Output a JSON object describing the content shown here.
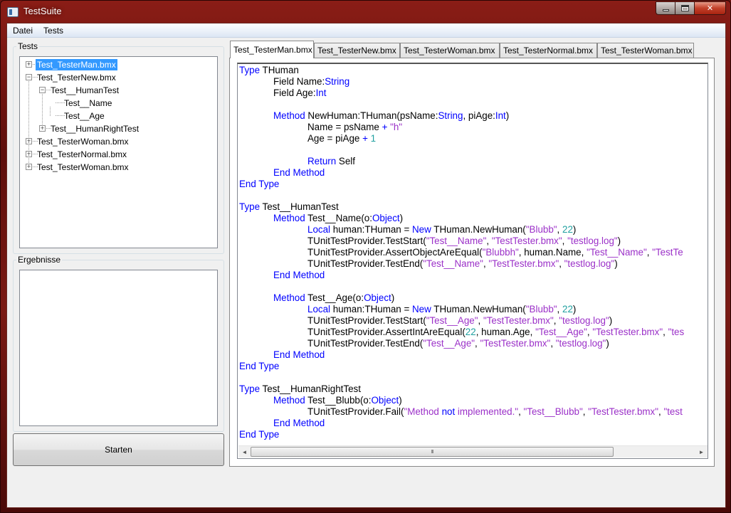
{
  "window": {
    "title": "TestSuite"
  },
  "menu": [
    "Datei",
    "Tests"
  ],
  "groups": {
    "tests": "Tests",
    "results": "Ergebnisse"
  },
  "tree": [
    {
      "label": "Test_TesterMan.bmx",
      "level": 0,
      "expander": "+",
      "selected": true
    },
    {
      "label": "Test_TesterNew.bmx",
      "level": 0,
      "expander": "-"
    },
    {
      "label": "Test__HumanTest",
      "level": 1,
      "expander": "-"
    },
    {
      "label": "Test__Name",
      "level": 2,
      "expander": ""
    },
    {
      "label": "Test__Age",
      "level": 2,
      "expander": ""
    },
    {
      "label": "Test__HumanRightTest",
      "level": 1,
      "expander": "+"
    },
    {
      "label": "Test_TesterWoman.bmx",
      "level": 0,
      "expander": "+"
    },
    {
      "label": "Test_TesterNormal.bmx",
      "level": 0,
      "expander": "+"
    },
    {
      "label": "Test_TesterWoman.bmx",
      "level": 0,
      "expander": "+"
    }
  ],
  "start_button": "Starten",
  "tabs": [
    "Test_TesterMan.bmx",
    "Test_TesterNew.bmx",
    "Test_TesterWoman.bmx",
    "Test_TesterNormal.bmx",
    "Test_TesterWoman.bmx"
  ],
  "active_tab": 0,
  "scrollbar": {
    "left_arrow": "◄",
    "right_arrow": "►",
    "grip": "III"
  },
  "code": [
    {
      "indent": 0,
      "tokens": [
        [
          "kw",
          "Type"
        ],
        [
          "t",
          " THuman"
        ]
      ]
    },
    {
      "indent": 1,
      "tokens": [
        [
          "t",
          "Field Name:"
        ],
        [
          "kw",
          "String"
        ]
      ]
    },
    {
      "indent": 1,
      "tokens": [
        [
          "t",
          "Field Age:"
        ],
        [
          "kw",
          "Int"
        ]
      ]
    },
    {
      "indent": 0,
      "tokens": []
    },
    {
      "indent": 1,
      "tokens": [
        [
          "kw",
          "Method"
        ],
        [
          "t",
          " NewHuman:THuman(psName:"
        ],
        [
          "kw",
          "String"
        ],
        [
          "t",
          ", piAge:"
        ],
        [
          "kw",
          "Int"
        ],
        [
          "t",
          ")"
        ]
      ]
    },
    {
      "indent": 2,
      "tokens": [
        [
          "t",
          "Name = psName "
        ],
        [
          "kw",
          "+"
        ],
        [
          "t",
          " "
        ],
        [
          "str",
          "\"h\""
        ]
      ]
    },
    {
      "indent": 2,
      "tokens": [
        [
          "t",
          "Age = piAge "
        ],
        [
          "kw",
          "+"
        ],
        [
          "t",
          " "
        ],
        [
          "num",
          "1"
        ]
      ]
    },
    {
      "indent": 0,
      "tokens": []
    },
    {
      "indent": 2,
      "tokens": [
        [
          "kw",
          "Return"
        ],
        [
          "t",
          " Self"
        ]
      ]
    },
    {
      "indent": 1,
      "tokens": [
        [
          "kw",
          "End Method"
        ]
      ]
    },
    {
      "indent": 0,
      "tokens": [
        [
          "kw",
          "End Type"
        ]
      ]
    },
    {
      "indent": 0,
      "tokens": []
    },
    {
      "indent": 0,
      "tokens": [
        [
          "kw",
          "Type"
        ],
        [
          "t",
          " Test__HumanTest"
        ]
      ]
    },
    {
      "indent": 1,
      "tokens": [
        [
          "kw",
          "Method"
        ],
        [
          "t",
          " Test__Name(o:"
        ],
        [
          "kw",
          "Object"
        ],
        [
          "t",
          ")"
        ]
      ]
    },
    {
      "indent": 2,
      "tokens": [
        [
          "kw",
          "Local"
        ],
        [
          "t",
          " human:THuman = "
        ],
        [
          "kw",
          "New"
        ],
        [
          "t",
          " THuman.NewHuman("
        ],
        [
          "str",
          "\"Blubb\""
        ],
        [
          "t",
          ", "
        ],
        [
          "num",
          "22"
        ],
        [
          "t",
          ")"
        ]
      ]
    },
    {
      "indent": 2,
      "tokens": [
        [
          "t",
          "TUnitTestProvider.TestStart("
        ],
        [
          "str",
          "\"Test__Name\""
        ],
        [
          "t",
          ", "
        ],
        [
          "str",
          "\"TestTester.bmx\""
        ],
        [
          "t",
          ", "
        ],
        [
          "str",
          "\"testlog.log\""
        ],
        [
          "t",
          ")"
        ]
      ]
    },
    {
      "indent": 2,
      "tokens": [
        [
          "t",
          "TUnitTestProvider.AssertObjectAreEqual("
        ],
        [
          "str",
          "\"Blubbh\""
        ],
        [
          "t",
          ", human.Name, "
        ],
        [
          "str",
          "\"Test__Name\""
        ],
        [
          "t",
          ", "
        ],
        [
          "str",
          "\"TestTe"
        ]
      ]
    },
    {
      "indent": 2,
      "tokens": [
        [
          "t",
          "TUnitTestProvider.TestEnd("
        ],
        [
          "str",
          "\"Test__Name\""
        ],
        [
          "t",
          ", "
        ],
        [
          "str",
          "\"TestTester.bmx\""
        ],
        [
          "t",
          ", "
        ],
        [
          "str",
          "\"testlog.log\""
        ],
        [
          "t",
          ")"
        ]
      ]
    },
    {
      "indent": 1,
      "tokens": [
        [
          "kw",
          "End Method"
        ]
      ]
    },
    {
      "indent": 0,
      "tokens": []
    },
    {
      "indent": 1,
      "tokens": [
        [
          "kw",
          "Method"
        ],
        [
          "t",
          " Test__Age(o:"
        ],
        [
          "kw",
          "Object"
        ],
        [
          "t",
          ")"
        ]
      ]
    },
    {
      "indent": 2,
      "tokens": [
        [
          "kw",
          "Local"
        ],
        [
          "t",
          " human:THuman = "
        ],
        [
          "kw",
          "New"
        ],
        [
          "t",
          " THuman.NewHuman("
        ],
        [
          "str",
          "\"Blubb\""
        ],
        [
          "t",
          ", "
        ],
        [
          "num",
          "22"
        ],
        [
          "t",
          ")"
        ]
      ]
    },
    {
      "indent": 2,
      "tokens": [
        [
          "t",
          "TUnitTestProvider.TestStart("
        ],
        [
          "str",
          "\"Test__Age\""
        ],
        [
          "t",
          ", "
        ],
        [
          "str",
          "\"TestTester.bmx\""
        ],
        [
          "t",
          ", "
        ],
        [
          "str",
          "\"testlog.log\""
        ],
        [
          "t",
          ")"
        ]
      ]
    },
    {
      "indent": 2,
      "tokens": [
        [
          "t",
          "TUnitTestProvider.AssertIntAreEqual("
        ],
        [
          "num",
          "22"
        ],
        [
          "t",
          ", human.Age, "
        ],
        [
          "str",
          "\"Test__Age\""
        ],
        [
          "t",
          ", "
        ],
        [
          "str",
          "\"TestTester.bmx\""
        ],
        [
          "t",
          ", "
        ],
        [
          "str",
          "\"tes"
        ]
      ]
    },
    {
      "indent": 2,
      "tokens": [
        [
          "t",
          "TUnitTestProvider.TestEnd("
        ],
        [
          "str",
          "\"Test__Age\""
        ],
        [
          "t",
          ", "
        ],
        [
          "str",
          "\"TestTester.bmx\""
        ],
        [
          "t",
          ", "
        ],
        [
          "str",
          "\"testlog.log\""
        ],
        [
          "t",
          ")"
        ]
      ]
    },
    {
      "indent": 1,
      "tokens": [
        [
          "kw",
          "End Method"
        ]
      ]
    },
    {
      "indent": 0,
      "tokens": [
        [
          "kw",
          "End Type"
        ]
      ]
    },
    {
      "indent": 0,
      "tokens": []
    },
    {
      "indent": 0,
      "tokens": [
        [
          "kw",
          "Type"
        ],
        [
          "t",
          " Test__HumanRightTest"
        ]
      ]
    },
    {
      "indent": 1,
      "tokens": [
        [
          "kw",
          "Method"
        ],
        [
          "t",
          " Test__Blubb(o:"
        ],
        [
          "kw",
          "Object"
        ],
        [
          "t",
          ")"
        ]
      ]
    },
    {
      "indent": 2,
      "tokens": [
        [
          "t",
          "TUnitTestProvider.Fail("
        ],
        [
          "str",
          "\"Method "
        ],
        [
          "kw",
          "not"
        ],
        [
          "str",
          " implemented.\""
        ],
        [
          "t",
          ", "
        ],
        [
          "str",
          "\"Test__Blubb\""
        ],
        [
          "t",
          ", "
        ],
        [
          "str",
          "\"TestTester.bmx\""
        ],
        [
          "t",
          ", "
        ],
        [
          "str",
          "\"test"
        ]
      ]
    },
    {
      "indent": 1,
      "tokens": [
        [
          "kw",
          "End Method"
        ]
      ]
    },
    {
      "indent": 0,
      "tokens": [
        [
          "kw",
          "End Type"
        ]
      ]
    }
  ]
}
